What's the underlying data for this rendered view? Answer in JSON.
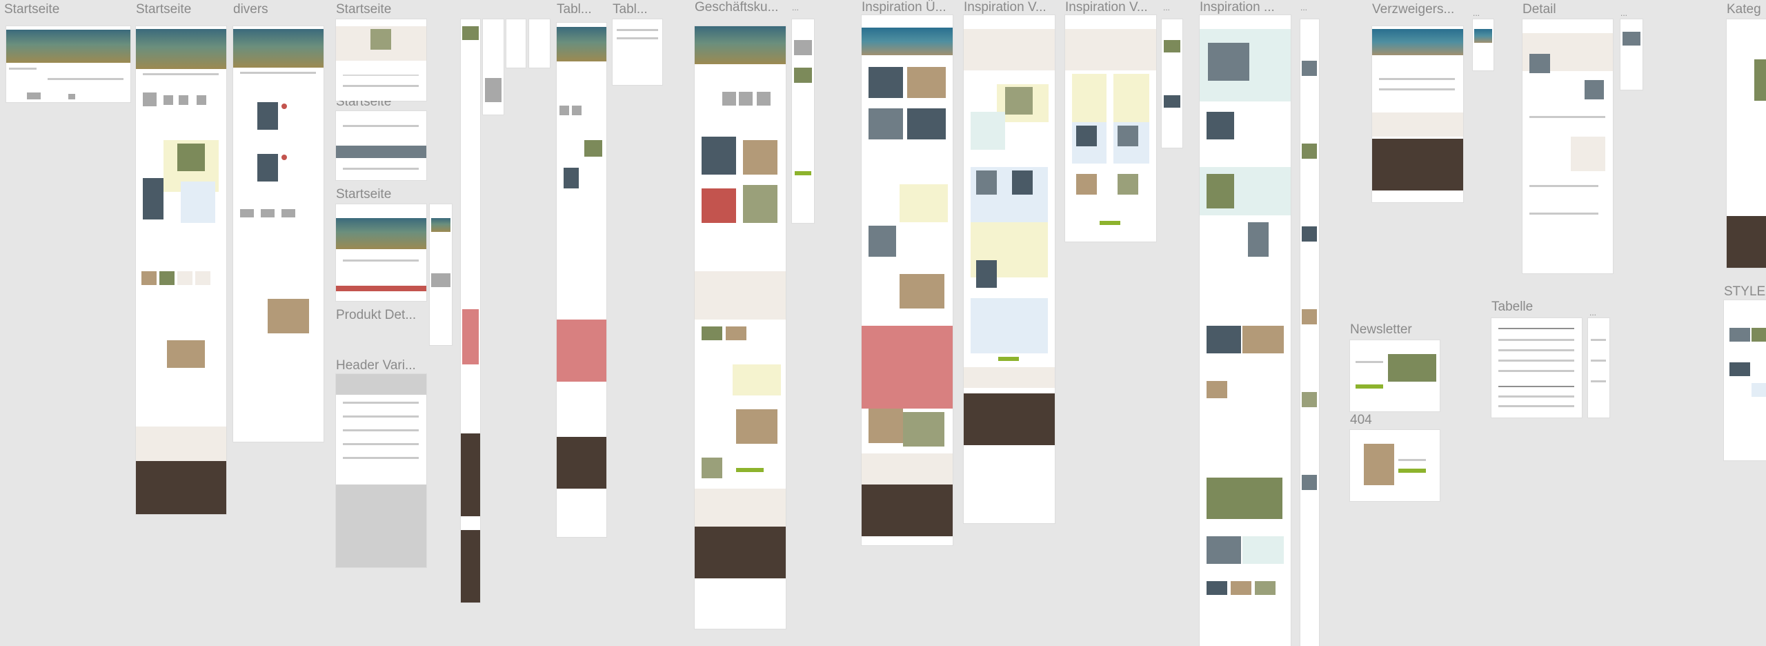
{
  "canvas": {
    "background": "#e6e6e6",
    "frame_labels": [
      {
        "id": "startseite-1",
        "text": "Startseite"
      },
      {
        "id": "startseite-2",
        "text": "Startseite"
      },
      {
        "id": "divers",
        "text": "divers"
      },
      {
        "id": "startseite-3",
        "text": "Startseite"
      },
      {
        "id": "startseite-4",
        "text": "Startseite"
      },
      {
        "id": "startseite-5",
        "text": "Startseite"
      },
      {
        "id": "produkt-det",
        "text": "Produkt Det..."
      },
      {
        "id": "header-vari",
        "text": "Header Vari..."
      },
      {
        "id": "tabl-1",
        "text": "Tabl..."
      },
      {
        "id": "tabl-2",
        "text": "Tabl..."
      },
      {
        "id": "geschaeftsku",
        "text": "Geschäftsku..."
      },
      {
        "id": "ellipsis-1",
        "text": "..."
      },
      {
        "id": "inspiration-1",
        "text": "Inspiration Ü..."
      },
      {
        "id": "inspiration-2",
        "text": "Inspiration V..."
      },
      {
        "id": "inspiration-3",
        "text": "Inspiration V..."
      },
      {
        "id": "ellipsis-2",
        "text": "..."
      },
      {
        "id": "inspiration-4",
        "text": "Inspiration ..."
      },
      {
        "id": "ellipsis-3",
        "text": "..."
      },
      {
        "id": "verzweigers",
        "text": "Verzweigers..."
      },
      {
        "id": "ellipsis-4",
        "text": "..."
      },
      {
        "id": "detail",
        "text": "Detail"
      },
      {
        "id": "ellipsis-5",
        "text": "..."
      },
      {
        "id": "kateg",
        "text": "Kateg"
      },
      {
        "id": "newsletter",
        "text": "Newsletter"
      },
      {
        "id": "tabelle",
        "text": "Tabelle"
      },
      {
        "id": "ellipsis-6",
        "text": "..."
      },
      {
        "id": "error-404",
        "text": "404"
      },
      {
        "id": "stylec",
        "text": "STYLEC"
      }
    ]
  },
  "colors": {
    "frame_bg": "#ffffff",
    "footer_dark": "#4a3c33",
    "accent_green": "#8db32d",
    "section_beige": "#f1ece6",
    "section_pink": "#d88080",
    "label_grey": "#8a8a8a"
  }
}
